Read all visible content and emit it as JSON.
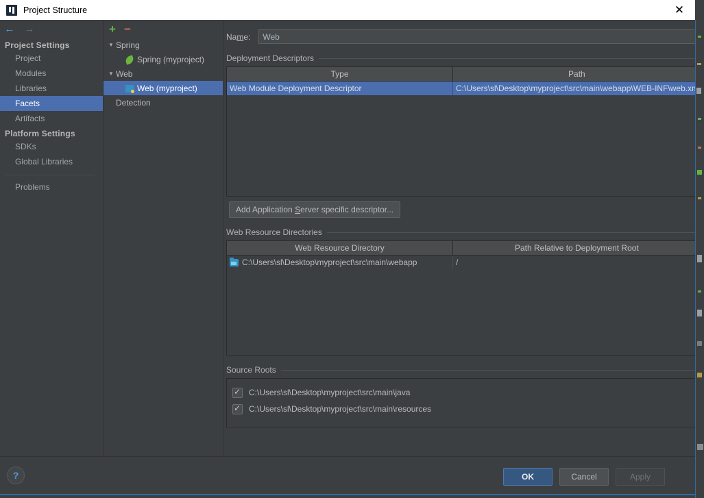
{
  "window": {
    "title": "Project Structure",
    "app_icon": "intellij-idea-icon",
    "close_label": "✕"
  },
  "nav": {
    "back_icon": "←",
    "forward_icon": "→",
    "groups": [
      {
        "label": "Project Settings",
        "items": [
          {
            "label": "Project",
            "selected": false
          },
          {
            "label": "Modules",
            "selected": false
          },
          {
            "label": "Libraries",
            "selected": false
          },
          {
            "label": "Facets",
            "selected": true
          },
          {
            "label": "Artifacts",
            "selected": false
          }
        ]
      },
      {
        "label": "Platform Settings",
        "items": [
          {
            "label": "SDKs",
            "selected": false
          },
          {
            "label": "Global Libraries",
            "selected": false
          }
        ]
      }
    ],
    "problems_label": "Problems"
  },
  "tree": {
    "toolbar": {
      "add": "+",
      "remove": "−"
    },
    "nodes": [
      {
        "label": "Spring",
        "type": "group",
        "caret": "▼",
        "selected": false
      },
      {
        "label": "Spring (myproject)",
        "type": "leaf",
        "icon": "spring-leaf-icon",
        "selected": false
      },
      {
        "label": "Web",
        "type": "group",
        "caret": "▼",
        "selected": false
      },
      {
        "label": "Web (myproject)",
        "type": "leaf",
        "icon": "web-module-icon",
        "selected": true
      },
      {
        "label": "Detection",
        "type": "plain",
        "selected": false
      }
    ]
  },
  "facet": {
    "name_label_pre": "Na",
    "name_label_mnemonic": "m",
    "name_label_post": "e:",
    "name_value": "Web",
    "deployment": {
      "title": "Deployment Descriptors",
      "columns": [
        "Type",
        "Path"
      ],
      "rows": [
        {
          "type": "Web Module Deployment Descriptor",
          "path": "C:\\Users\\sl\\Desktop\\myproject\\src\\main\\webapp\\WEB-INF\\web.xml",
          "selected": true
        }
      ],
      "tools": [
        "add-icon",
        "remove-icon",
        "edit-icon"
      ]
    },
    "add_server_button": {
      "pre": "Add Application ",
      "mnemonic": "S",
      "post": "erver specific descriptor..."
    },
    "web_resources": {
      "title": "Web Resource Directories",
      "columns": [
        "Web Resource Directory",
        "Path Relative to Deployment Root"
      ],
      "rows": [
        {
          "directory": "C:\\Users\\sl\\Desktop\\myproject\\src\\main\\webapp",
          "relative_path": "/",
          "icon": "folder-icon"
        }
      ],
      "tools": [
        "add-icon",
        "remove-icon",
        "edit-icon",
        "help-icon"
      ]
    },
    "source_roots": {
      "title": "Source Roots",
      "items": [
        {
          "path": "C:\\Users\\sl\\Desktop\\myproject\\src\\main\\java",
          "checked": true
        },
        {
          "path": "C:\\Users\\sl\\Desktop\\myproject\\src\\main\\resources",
          "checked": true
        }
      ]
    }
  },
  "footer": {
    "help_icon": "?",
    "ok_label": "OK",
    "cancel_label": "Cancel",
    "apply_label": "Apply"
  },
  "colors": {
    "selection_blue": "#4b6eaf",
    "primary_button": "#365880",
    "accent_green": "#62b543",
    "accent_red": "#c9705a",
    "accent_cyan": "#3592c4",
    "dialog_bg": "#3c3f41"
  }
}
